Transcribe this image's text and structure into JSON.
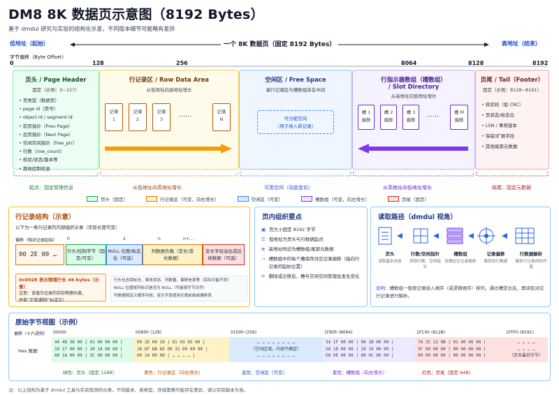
{
  "title": "DM8 8K 数据页示意图（8192 Bytes）",
  "subtitle": "基于 dmdul 研究与实验的结构化示意，不同版本细节可能略有差异",
  "address": {
    "low": "低地址（起始）",
    "high": "高地址（结束）",
    "page_label": "一个 8K 数据页（固定 8192 Bytes）"
  },
  "offset_label": "字节偏移（Byte Offset）",
  "ticks": [
    "0",
    "128",
    "256",
    "8064",
    "8128",
    "8192"
  ],
  "header": {
    "title": "页头 / Page Header",
    "sub": "固定（示例：0~127）",
    "items": [
      "页类型（数据页）",
      "page id（页号）",
      "object id / segment id",
      "前页指针（Prev Page）",
      "后页指针（Next Page）",
      "空闲空间指针（free_ptr）",
      "行数（row_count）",
      "校验/状态/版本等",
      "其他控制信息"
    ]
  },
  "rows": {
    "title": "行记录区 / Row Data Area",
    "sub": "从低地址向高地址增长",
    "records": [
      [
        "记录",
        "1"
      ],
      [
        "记录",
        "2"
      ],
      [
        "记录",
        "3"
      ],
      [
        "记录",
        "N"
      ]
    ],
    "ellipsis": "……"
  },
  "free": {
    "title": "空闲区 / Free Space",
    "sub": "被行记录区与槽数组夹在中间",
    "box_line1": "可分配空间",
    "box_line2": "（用于插入新记录）"
  },
  "slots": {
    "title": "行指示器数组（槽数组）",
    "title2": "/ Slot Directory",
    "sub": "从高地址向低地址增长",
    "items": [
      [
        "槽 1",
        "偏移"
      ],
      [
        "槽 2",
        "偏移"
      ],
      [
        "槽 3",
        "偏移"
      ],
      [
        "槽 M",
        "偏移"
      ]
    ],
    "ellipsis": "……"
  },
  "tail": {
    "title": "页尾 / Tail（Footer）",
    "sub": "固定（示例：8128~8191）",
    "items": [
      "校验码（如 CRC）",
      "页状态/标志位",
      "LSN / 事务版本",
      "保留/扩展字段",
      "其他尾部元数据"
    ]
  },
  "below_labels": {
    "start": "起点：固定管理信息",
    "grow_up": "从低地址向高地址增长",
    "free": "可用空间（动态变化）",
    "grow_down": "从高地址向低地址增长",
    "end": "结尾：固定元数据"
  },
  "legend": [
    {
      "label": "页头（固定）",
      "color": "#dcfce7",
      "border": "#16a34a"
    },
    {
      "label": "行记录区（可变，向右增长）",
      "color": "#fef3c7",
      "border": "#d97706"
    },
    {
      "label": "空闲区（可变）",
      "color": "#dbeafe",
      "border": "#3b82f6"
    },
    {
      "label": "槽数组（可变，向左增长）",
      "color": "#ede9fe",
      "border": "#7c3aed"
    },
    {
      "label": "页尾（固定）",
      "color": "#fee2e2",
      "border": "#dc2626"
    }
  ],
  "row_struct": {
    "title": "行记录结构（示意）",
    "sub": "以下为一条行记录的内部组织示意（实际长度可变）",
    "offset_label": "偏移（相对记录起始）",
    "offset_ticks": [
      "0",
      "2",
      "n",
      "n+…"
    ],
    "hex": "00 2E 00 …",
    "fields": [
      "行头/控制字节（固定/可变）",
      "NULL 位图/标志位（可选）",
      "列数据负载（定长/变长数据）",
      "变长字段溢出或后续数据（可选）"
    ],
    "note1": "0x002E 表示物理行长 46 bytes（示意）",
    "note2": "注意：该值为记录的实际物理长度，",
    "note3": "并非“正常/删除”标志位！",
    "bullets": [
      "行头包含锁标志、事务状态、列数量、偏移信息等（实际可能不同）",
      "NULL 位图按列标识是否为 NULL（可能按字节对齐）",
      "列数据按定义顺序存放；变长字段使用长度前缀或偏移表"
    ]
  },
  "org": {
    "title": "页内组织要点",
    "items": [
      "页大小固定 8192 字节",
      "低地址为页头与行数据起点",
      "高地址附近为槽数组/尾部元数据",
      "槽数组中的每个槽保存对应记录偏移（指向行记录的起始位置）",
      "删除或迁移后，槽与空闲空间管理会发生变化"
    ]
  },
  "read": {
    "title": "读取路径（dmdul 视角）",
    "steps": [
      {
        "t": "页头",
        "d": "读取基本信息"
      },
      {
        "t": "行数/空闲指针",
        "d": "获取行数、空闲指针"
      },
      {
        "t": "槽数组",
        "d": "按槽定位记录偏移"
      },
      {
        "t": "记录偏移",
        "d": "跳转到行数据"
      },
      {
        "t": "行数据解析",
        "d": "解析行记录得到列值"
      }
    ],
    "note_prefix": "说明：",
    "note": "槽数组一般按记录插入顺序（或逻辑顺序）排列，通过槽定位后，再读取对应行记录进行解析。"
  },
  "raw": {
    "title": "原始字节视图（示例）",
    "offset_hdr": "偏移（十六进制）",
    "hex_label": "Hex 数据",
    "cols": [
      {
        "off": "0000h",
        "lines": [
          "44 4D 38 00 | 01 00 00 00 |",
          "10 27 00 00 | 20 1A 00 00 |",
          "A0 1A 00 00 | 5C 00 00 00 |"
        ]
      },
      {
        "off": "0080h (128)",
        "lines": [
          "00 2E 00 10 | 81 03 05 00 |",
          "JA 6F 6B 6E 00 32 00 09 00 |",
          "00 1A 00 08 | … … … … |"
        ]
      },
      {
        "off": "0100h (256)",
        "lines": [
          "… … … … … … … …",
          "（空闲区域，内容不确定）",
          "… … … … … … … …"
        ]
      },
      {
        "off": "1F80h (8064)",
        "lines": [
          "34 1F 00 00 | 90 1B 00 00 |",
          "58 1D 00 00 | 20 10 00 00 |",
          "E8 0E 00 00 | A0 0C 00 00 |"
        ]
      },
      {
        "off": "1FC0h (8128)",
        "lines": [
          "7A 3C 12 9B | 01 00 00 00 |",
          "5F 00 00 00 | 00 00 00 00 |",
          "00 00 00 00 | 00 00 00 00 |"
        ]
      },
      {
        "off": "1FFFh (8191)",
        "lines": [
          "… … … …",
          "… … … …",
          "（页末最后字节）"
        ]
      }
    ],
    "col_labels": [
      "绿色：页头（固定 128B）",
      "黄色：行记录区（向右增长）",
      "蓝色：空闲区（可变）",
      "紫色：槽数组（向左增长）",
      "红色：页尾（固定 64B）"
    ]
  },
  "footnote": "注：以上结构为基于 dmdul 工具与实验观测的示意，不同版本、表类型、存储策略可能存在差异，请以实际版本为准。"
}
